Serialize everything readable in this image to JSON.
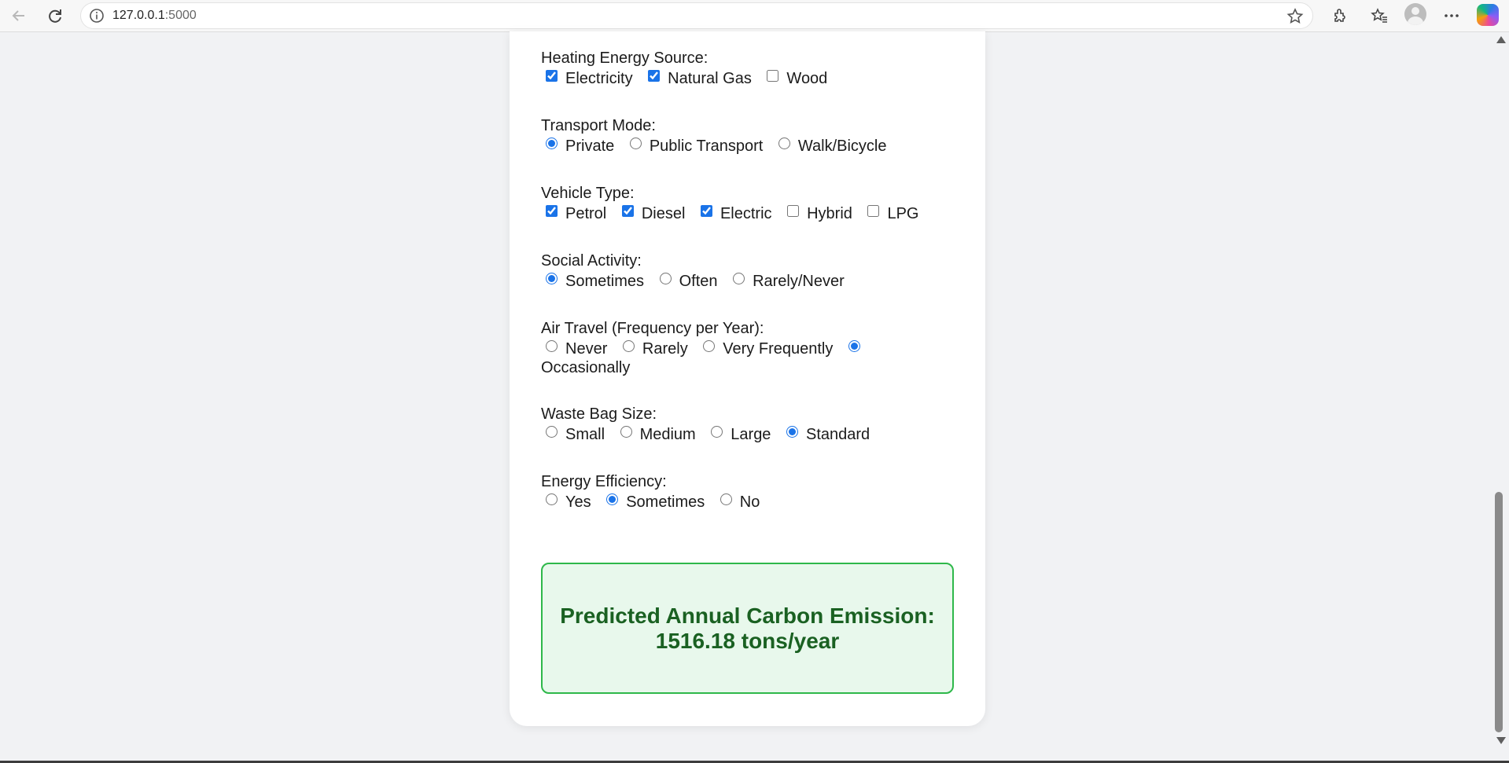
{
  "browser": {
    "url_host": "127.0.0.1",
    "url_port": ":5000"
  },
  "form": {
    "heating": {
      "label": "Heating Energy Source:",
      "options": [
        {
          "label": "Electricity",
          "checked": true
        },
        {
          "label": "Natural Gas",
          "checked": true
        },
        {
          "label": "Wood",
          "checked": false
        }
      ]
    },
    "transport": {
      "label": "Transport Mode:",
      "options": [
        {
          "label": "Private",
          "checked": true
        },
        {
          "label": "Public Transport",
          "checked": false
        },
        {
          "label": "Walk/Bicycle",
          "checked": false
        }
      ]
    },
    "vehicle": {
      "label": "Vehicle Type:",
      "options": [
        {
          "label": "Petrol",
          "checked": true
        },
        {
          "label": "Diesel",
          "checked": true
        },
        {
          "label": "Electric",
          "checked": true
        },
        {
          "label": "Hybrid",
          "checked": false
        },
        {
          "label": "LPG",
          "checked": false
        }
      ]
    },
    "social": {
      "label": "Social Activity:",
      "options": [
        {
          "label": "Sometimes",
          "checked": true
        },
        {
          "label": "Often",
          "checked": false
        },
        {
          "label": "Rarely/Never",
          "checked": false
        }
      ]
    },
    "air": {
      "label": "Air Travel (Frequency per Year):",
      "options": [
        {
          "label": "Never",
          "checked": false
        },
        {
          "label": "Rarely",
          "checked": false
        },
        {
          "label": "Very Frequently",
          "checked": false
        },
        {
          "label": "Occasionally",
          "checked": true
        }
      ]
    },
    "waste": {
      "label": "Waste Bag Size:",
      "options": [
        {
          "label": "Small",
          "checked": false
        },
        {
          "label": "Medium",
          "checked": false
        },
        {
          "label": "Large",
          "checked": false
        },
        {
          "label": "Standard",
          "checked": true
        }
      ]
    },
    "efficiency": {
      "label": "Energy Efficiency:",
      "options": [
        {
          "label": "Yes",
          "checked": false
        },
        {
          "label": "Sometimes",
          "checked": true
        },
        {
          "label": "No",
          "checked": false
        }
      ]
    }
  },
  "result": {
    "line1": "Predicted Annual Carbon Emission:",
    "line2": "1516.18 tons/year"
  },
  "colors": {
    "accent": "#1a73e8",
    "result_border": "#2eb84a",
    "result_bg": "#e8f8ec",
    "result_text": "#1a6122"
  }
}
